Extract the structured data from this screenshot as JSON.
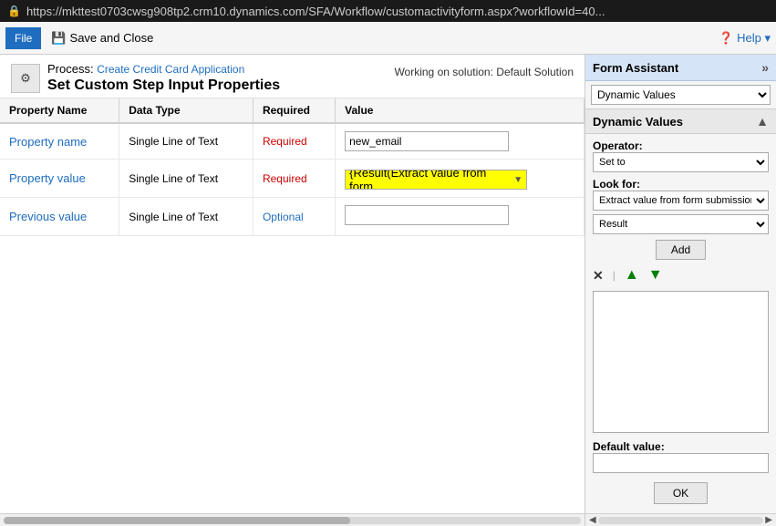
{
  "titlebar": {
    "lock_icon": "🔒",
    "url": "https://mkttest0703cwsg908tp2.crm10.dynamics.com/SFA/Workflow/customactivityform.aspx?workflowId=40..."
  },
  "toolbar": {
    "file_label": "File",
    "save_close_icon": "💾",
    "save_close_label": "Save and Close",
    "help_icon": "❓",
    "help_label": "Help ▾"
  },
  "header": {
    "gear_icon": "⚙",
    "process_prefix": "Process: ",
    "process_link": "Create Credit Card Application",
    "page_title": "Set Custom Step Input Properties",
    "working_on": "Working on solution: Default Solution"
  },
  "table": {
    "columns": [
      "Property Name",
      "Data Type",
      "Required",
      "Value"
    ],
    "rows": [
      {
        "prop_name": "Property name",
        "data_type": "Single Line of Text",
        "required": "Required",
        "value_type": "text",
        "value": "new_email"
      },
      {
        "prop_name": "Property value",
        "data_type": "Single Line of Text",
        "required": "Required",
        "value_type": "dynamic",
        "value": "{Result(Extract value from form"
      },
      {
        "prop_name": "Previous value",
        "data_type": "Single Line of Text",
        "required": "Optional",
        "value_type": "empty",
        "value": ""
      }
    ]
  },
  "form_assistant": {
    "title": "Form Assistant",
    "expand_icon": "»",
    "dropdown1": {
      "selected": "Dynamic Values",
      "options": [
        "Dynamic Values"
      ]
    },
    "dynamic_values": {
      "title": "Dynamic Values",
      "collapse_icon": "▲",
      "operator_label": "Operator:",
      "operator_select": {
        "selected": "Set to",
        "options": [
          "Set to"
        ]
      },
      "look_for_label": "Look for:",
      "look_for_select": {
        "selected": "Extract value from form submission",
        "options": [
          "Extract value from form submission"
        ]
      },
      "result_select": {
        "selected": "Result",
        "options": [
          "Result"
        ]
      },
      "add_button": "Add",
      "x_icon": "✕",
      "up_icon": "▲",
      "down_icon": "▼",
      "default_value_label": "Default value:",
      "default_value": "",
      "ok_button": "OK"
    }
  }
}
